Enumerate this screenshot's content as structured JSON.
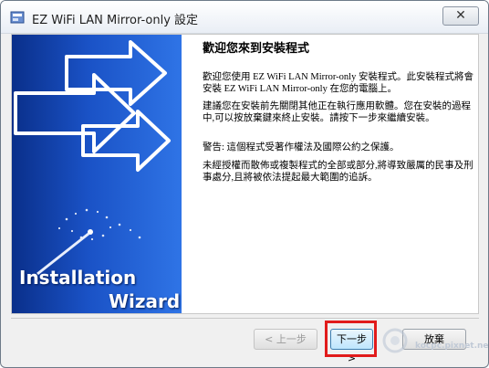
{
  "window": {
    "title": "EZ WiFi LAN Mirror-only 設定",
    "close_glyph": "✕"
  },
  "banner": {
    "line1": "Installation",
    "line2": "Wizard"
  },
  "main": {
    "heading": "歡迎您來到安裝程式",
    "paragraphs": [
      "歡迎您使用 EZ WiFi LAN Mirror-only 安裝程式。此安裝程式將會安裝 EZ WiFi LAN Mirror-only 在您的電腦上。",
      "建議您在安裝前先關閉其他正在執行應用軟體。您在安裝的過程中,可以按放棄鍵來終止安裝。請按下一步來繼續安裝。",
      "警告: 這個程式受著作權法及國際公約之保護。",
      "未經授權而散佈或複製程式的全部或部分,將導致嚴厲的民事及刑事處分,且將被依法提起最大範圍的追訴。"
    ]
  },
  "buttons": {
    "back": "< 上一步",
    "next": "下一步 >",
    "cancel": "放棄"
  },
  "watermark": {
    "text": "kocpc.pixnet.net"
  },
  "colors": {
    "highlight": "#e11b1b",
    "banner_dark": "#0a2f8a",
    "banner_light": "#2f74e6"
  }
}
